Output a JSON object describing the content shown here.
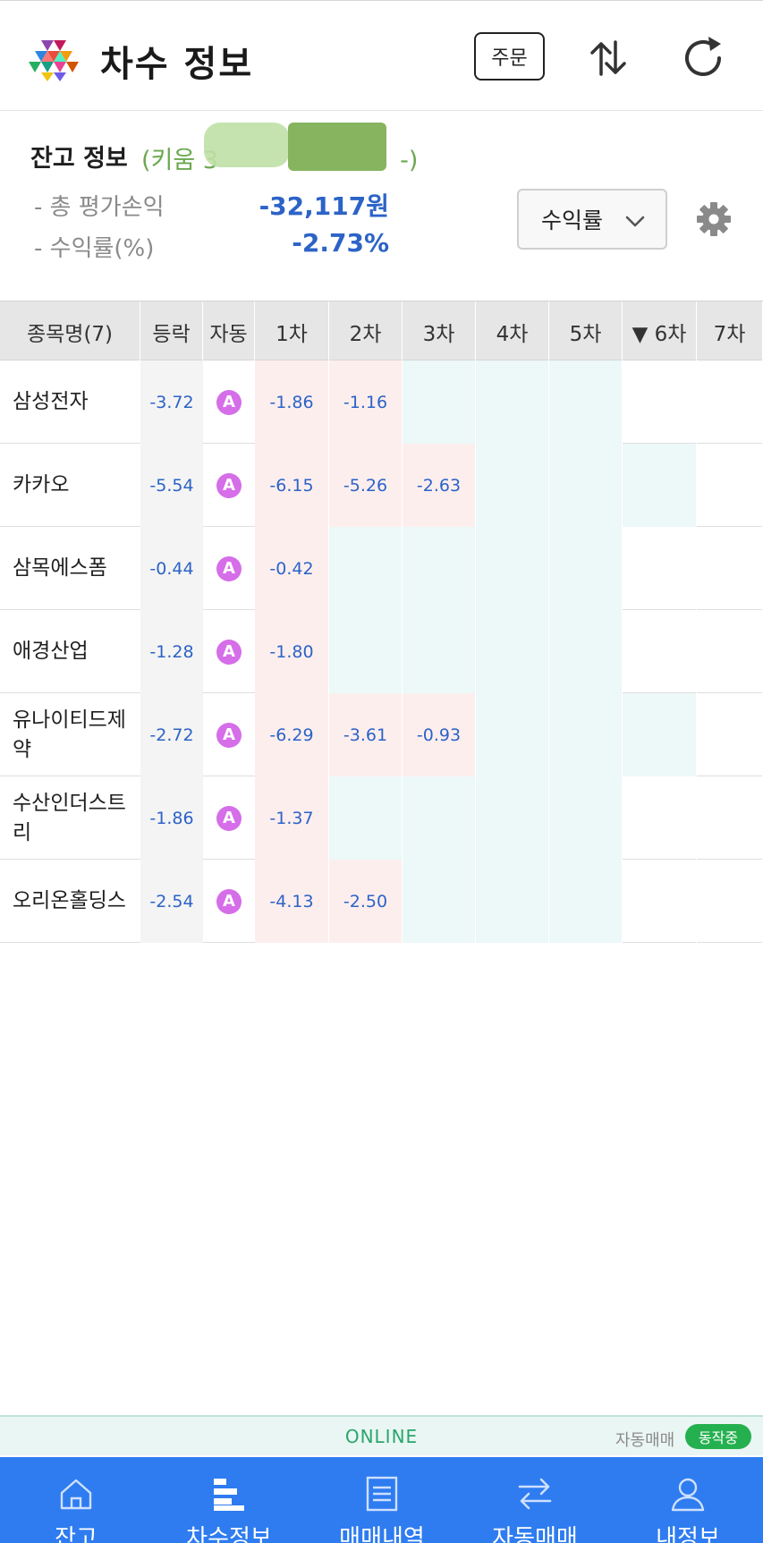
{
  "header": {
    "title": "차수 정보",
    "order_label": "주문",
    "icons": [
      "app-logo",
      "swap-vertical-icon",
      "refresh-icon"
    ]
  },
  "balance": {
    "title": "잔고 정보",
    "account_prefix": "(키움 3",
    "account_suffix": "-)",
    "total_eval_label": "- 총 평가손익",
    "total_eval_value": "-32,117원",
    "return_label": "- 수익률(%)",
    "return_value": "-2.73%",
    "sort_label": "수익률"
  },
  "table": {
    "columns": [
      "종목명(7)",
      "등락",
      "자동",
      "1차",
      "2차",
      "3차",
      "4차",
      "5차",
      "▼ 6차",
      "7차"
    ],
    "rows": [
      {
        "name": "삼성전자",
        "change": "-3.72",
        "auto": "A",
        "steps": [
          "-1.86",
          "-1.16",
          "",
          "",
          "",
          "",
          ""
        ]
      },
      {
        "name": "카카오",
        "change": "-5.54",
        "auto": "A",
        "steps": [
          "-6.15",
          "-5.26",
          "-2.63",
          "",
          "",
          "",
          ""
        ]
      },
      {
        "name": "삼목에스폼",
        "change": "-0.44",
        "auto": "A",
        "steps": [
          "-0.42",
          "",
          "",
          "",
          "",
          "",
          ""
        ]
      },
      {
        "name": "애경산업",
        "change": "-1.28",
        "auto": "A",
        "steps": [
          "-1.80",
          "",
          "",
          "",
          "",
          "",
          ""
        ]
      },
      {
        "name": "유나이티드제약",
        "change": "-2.72",
        "auto": "A",
        "steps": [
          "-6.29",
          "-3.61",
          "-0.93",
          "",
          "",
          "",
          ""
        ]
      },
      {
        "name": "수산인더스트리",
        "change": "-1.86",
        "auto": "A",
        "steps": [
          "-1.37",
          "",
          "",
          "",
          "",
          "",
          ""
        ]
      },
      {
        "name": "오리온홀딩스",
        "change": "-2.54",
        "auto": "A",
        "steps": [
          "-4.13",
          "-2.50",
          "",
          "",
          "",
          "",
          ""
        ]
      }
    ]
  },
  "status": {
    "online": "ONLINE",
    "auto_trade_label": "자동매매",
    "auto_trade_badge": "동작중"
  },
  "nav": {
    "items": [
      {
        "label": "잔고",
        "icon": "home-icon"
      },
      {
        "label": "차수정보",
        "icon": "bars-icon"
      },
      {
        "label": "매매내역",
        "icon": "document-icon"
      },
      {
        "label": "자동매매",
        "icon": "transfer-icon"
      },
      {
        "label": "내정보",
        "icon": "user-icon"
      }
    ]
  },
  "colors": {
    "accent_blue": "#2e7cf0",
    "value_blue": "#2c63c7",
    "account_green": "#6aa84f",
    "auto_badge_purple": "#d56ee8",
    "online_green": "#2aa66a"
  }
}
